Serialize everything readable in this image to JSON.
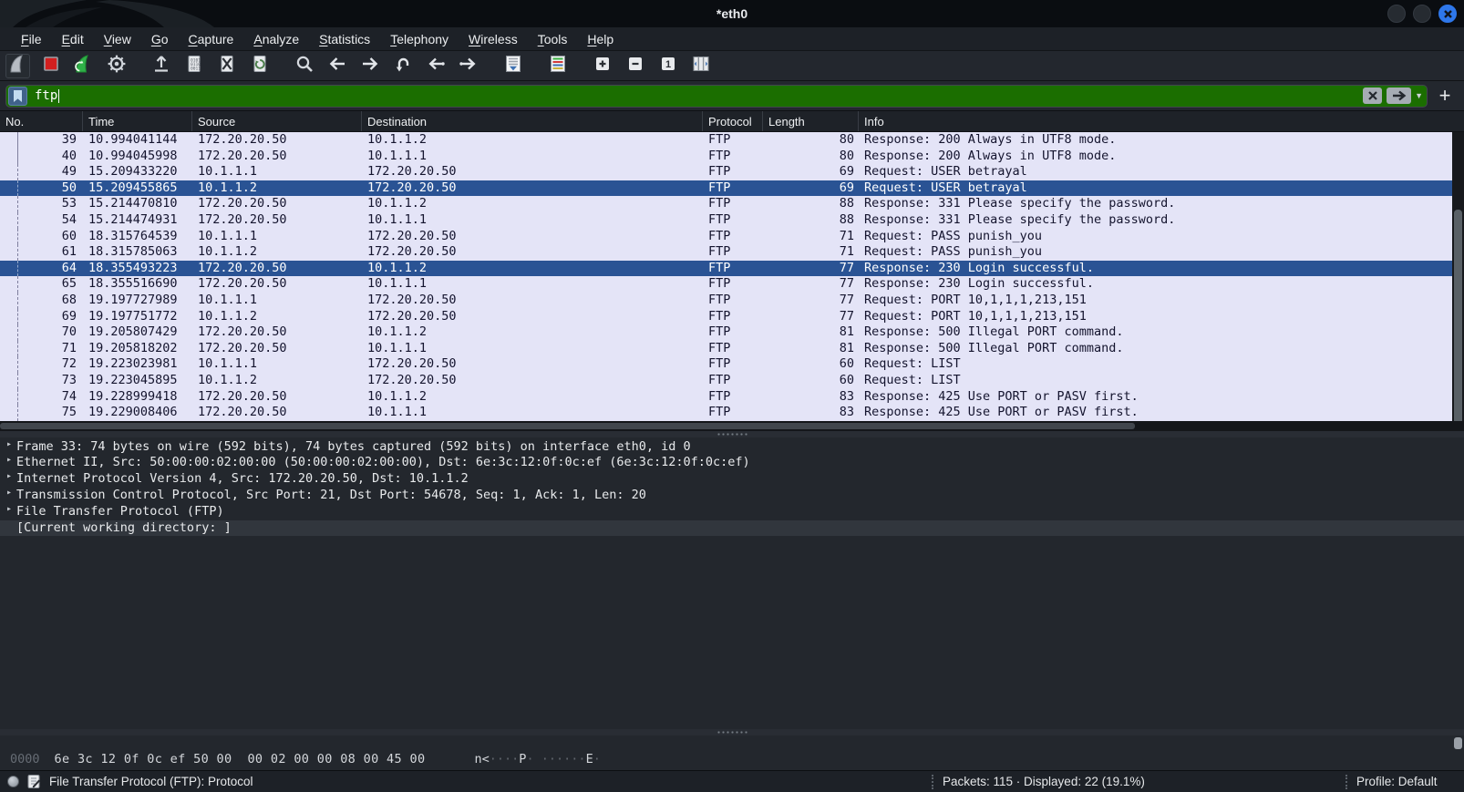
{
  "window": {
    "title": "*eth0"
  },
  "titlebar_icons": [
    "minimize",
    "maximize",
    "close"
  ],
  "menu": [
    "File",
    "Edit",
    "View",
    "Go",
    "Capture",
    "Analyze",
    "Statistics",
    "Telephony",
    "Wireless",
    "Tools",
    "Help"
  ],
  "toolbar": [
    {
      "name": "start-capture",
      "icon": "fin"
    },
    {
      "name": "stop-capture",
      "icon": "stop"
    },
    {
      "name": "restart-capture",
      "icon": "fin-restart"
    },
    {
      "name": "capture-options",
      "icon": "gear"
    },
    {
      "name": "open-file",
      "icon": "open"
    },
    {
      "name": "save-file",
      "icon": "save"
    },
    {
      "name": "close-file",
      "icon": "close-doc"
    },
    {
      "name": "reload-file",
      "icon": "reload"
    },
    {
      "name": "find-packet",
      "icon": "find"
    },
    {
      "name": "go-back",
      "icon": "arrow-left"
    },
    {
      "name": "go-forward",
      "icon": "arrow-right"
    },
    {
      "name": "go-to-packet",
      "icon": "goto"
    },
    {
      "name": "go-first",
      "icon": "first"
    },
    {
      "name": "go-last",
      "icon": "last"
    },
    {
      "name": "auto-scroll",
      "icon": "autoscroll"
    },
    {
      "name": "colorize",
      "icon": "colorize"
    },
    {
      "name": "zoom-in",
      "icon": "zoom-in"
    },
    {
      "name": "zoom-out",
      "icon": "zoom-out"
    },
    {
      "name": "normal-size",
      "icon": "normal-size"
    },
    {
      "name": "resize-columns",
      "icon": "resize-columns"
    }
  ],
  "filter": {
    "value": "ftp"
  },
  "packet_list": {
    "columns": [
      "No.",
      "Time",
      "Source",
      "Destination",
      "Protocol",
      "Length",
      "Info"
    ],
    "rows": [
      {
        "no": "39",
        "time": "10.994041144",
        "src": "172.20.20.50",
        "dst": "10.1.1.2",
        "proto": "FTP",
        "len": "80",
        "info": "Response: 200 Always in UTF8 mode.",
        "selected": false
      },
      {
        "no": "40",
        "time": "10.994045998",
        "src": "172.20.20.50",
        "dst": "10.1.1.1",
        "proto": "FTP",
        "len": "80",
        "info": "Response: 200 Always in UTF8 mode.",
        "selected": false
      },
      {
        "no": "49",
        "time": "15.209433220",
        "src": "10.1.1.1",
        "dst": "172.20.20.50",
        "proto": "FTP",
        "len": "69",
        "info": "Request: USER betrayal",
        "selected": false
      },
      {
        "no": "50",
        "time": "15.209455865",
        "src": "10.1.1.2",
        "dst": "172.20.20.50",
        "proto": "FTP",
        "len": "69",
        "info": "Request: USER betrayal",
        "selected": true
      },
      {
        "no": "53",
        "time": "15.214470810",
        "src": "172.20.20.50",
        "dst": "10.1.1.2",
        "proto": "FTP",
        "len": "88",
        "info": "Response: 331 Please specify the password.",
        "selected": false
      },
      {
        "no": "54",
        "time": "15.214474931",
        "src": "172.20.20.50",
        "dst": "10.1.1.1",
        "proto": "FTP",
        "len": "88",
        "info": "Response: 331 Please specify the password.",
        "selected": false
      },
      {
        "no": "60",
        "time": "18.315764539",
        "src": "10.1.1.1",
        "dst": "172.20.20.50",
        "proto": "FTP",
        "len": "71",
        "info": "Request: PASS punish_you",
        "selected": false
      },
      {
        "no": "61",
        "time": "18.315785063",
        "src": "10.1.1.2",
        "dst": "172.20.20.50",
        "proto": "FTP",
        "len": "71",
        "info": "Request: PASS punish_you",
        "selected": false
      },
      {
        "no": "64",
        "time": "18.355493223",
        "src": "172.20.20.50",
        "dst": "10.1.1.2",
        "proto": "FTP",
        "len": "77",
        "info": "Response: 230 Login successful.",
        "selected": true
      },
      {
        "no": "65",
        "time": "18.355516690",
        "src": "172.20.20.50",
        "dst": "10.1.1.1",
        "proto": "FTP",
        "len": "77",
        "info": "Response: 230 Login successful.",
        "selected": false
      },
      {
        "no": "68",
        "time": "19.197727989",
        "src": "10.1.1.1",
        "dst": "172.20.20.50",
        "proto": "FTP",
        "len": "77",
        "info": "Request: PORT 10,1,1,1,213,151",
        "selected": false
      },
      {
        "no": "69",
        "time": "19.197751772",
        "src": "10.1.1.2",
        "dst": "172.20.20.50",
        "proto": "FTP",
        "len": "77",
        "info": "Request: PORT 10,1,1,1,213,151",
        "selected": false
      },
      {
        "no": "70",
        "time": "19.205807429",
        "src": "172.20.20.50",
        "dst": "10.1.1.2",
        "proto": "FTP",
        "len": "81",
        "info": "Response: 500 Illegal PORT command.",
        "selected": false
      },
      {
        "no": "71",
        "time": "19.205818202",
        "src": "172.20.20.50",
        "dst": "10.1.1.1",
        "proto": "FTP",
        "len": "81",
        "info": "Response: 500 Illegal PORT command.",
        "selected": false
      },
      {
        "no": "72",
        "time": "19.223023981",
        "src": "10.1.1.1",
        "dst": "172.20.20.50",
        "proto": "FTP",
        "len": "60",
        "info": "Request: LIST",
        "selected": false
      },
      {
        "no": "73",
        "time": "19.223045895",
        "src": "10.1.1.2",
        "dst": "172.20.20.50",
        "proto": "FTP",
        "len": "60",
        "info": "Request: LIST",
        "selected": false
      },
      {
        "no": "74",
        "time": "19.228999418",
        "src": "172.20.20.50",
        "dst": "10.1.1.2",
        "proto": "FTP",
        "len": "83",
        "info": "Response: 425 Use PORT or PASV first.",
        "selected": false
      },
      {
        "no": "75",
        "time": "19.229008406",
        "src": "172.20.20.50",
        "dst": "10.1.1.1",
        "proto": "FTP",
        "len": "83",
        "info": "Response: 425 Use PORT or PASV first.",
        "selected": false
      }
    ]
  },
  "details": {
    "rows": [
      {
        "text": "Frame 33: 74 bytes on wire (592 bits), 74 bytes captured (592 bits) on interface eth0, id 0",
        "expandable": true,
        "highlight": false
      },
      {
        "text": "Ethernet II, Src: 50:00:00:02:00:00 (50:00:00:02:00:00), Dst: 6e:3c:12:0f:0c:ef (6e:3c:12:0f:0c:ef)",
        "expandable": true,
        "highlight": false
      },
      {
        "text": "Internet Protocol Version 4, Src: 172.20.20.50, Dst: 10.1.1.2",
        "expandable": true,
        "highlight": false
      },
      {
        "text": "Transmission Control Protocol, Src Port: 21, Dst Port: 54678, Seq: 1, Ack: 1, Len: 20",
        "expandable": true,
        "highlight": false
      },
      {
        "text": "File Transfer Protocol (FTP)",
        "expandable": true,
        "highlight": false
      },
      {
        "text": "[Current working directory: ]",
        "expandable": false,
        "highlight": true
      }
    ]
  },
  "bytes": {
    "offset": "0000",
    "hex": "6e 3c 12 0f 0c ef 50 00  00 02 00 00 08 00 45 00",
    "ascii": "n<····P· ······E·"
  },
  "statusbar": {
    "left_text": "File Transfer Protocol (FTP): Protocol",
    "packets_text": "Packets: 115 · Displayed: 22 (19.1%)",
    "profile_text": "Profile: Default"
  },
  "colors": {
    "filter-valid": "#1b6e00",
    "selected-row": "#2a5394",
    "row-bg": "#e4e4f7",
    "close-button": "#2e77ea",
    "accent-green": "#2fb148",
    "stop-red": "#d21f1f"
  }
}
